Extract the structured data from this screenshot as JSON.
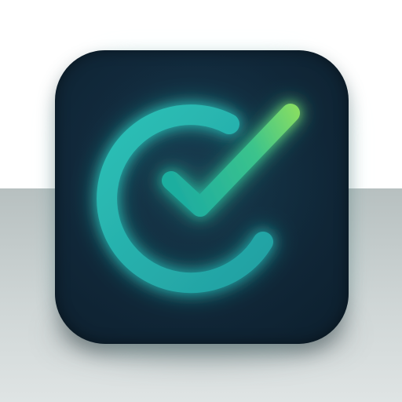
{
  "app_icon": {
    "name": "check-circle-app-icon",
    "colors": {
      "tile_dark": "#0d1f2d",
      "tile_light": "#163247",
      "ring_teal": "#2bb8b0",
      "ring_teal_deep": "#1f9b9a",
      "check_teal": "#22b5a4",
      "check_green": "#7ad96b",
      "halo": "#d7fffb",
      "backdrop": "#c7cfcf"
    },
    "icons": [
      "circular-arc-icon",
      "check-mark-icon"
    ]
  }
}
